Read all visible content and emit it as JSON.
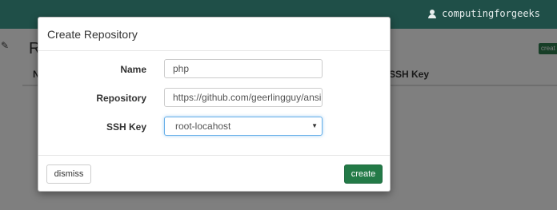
{
  "topbar": {
    "username": "computingforgeeks"
  },
  "page": {
    "title": "R",
    "create_badge": "creat"
  },
  "table": {
    "columns": [
      "N",
      "SSH Key"
    ]
  },
  "modal": {
    "title": "Create Repository",
    "fields": [
      {
        "label": "Name",
        "value": "php"
      },
      {
        "label": "Repository",
        "value": "https://github.com/geerlingguy/ansible-"
      },
      {
        "label": "SSH Key",
        "value": "root-locahost"
      }
    ],
    "buttons": {
      "dismiss": "dismiss",
      "create": "create"
    }
  },
  "colors": {
    "topbar": "#1f4f48",
    "primary": "#237a47",
    "focus": "#66afe9"
  },
  "icons": {
    "user": "user-icon",
    "edit": "edit-icon",
    "select_caret": "caret-down-icon"
  }
}
